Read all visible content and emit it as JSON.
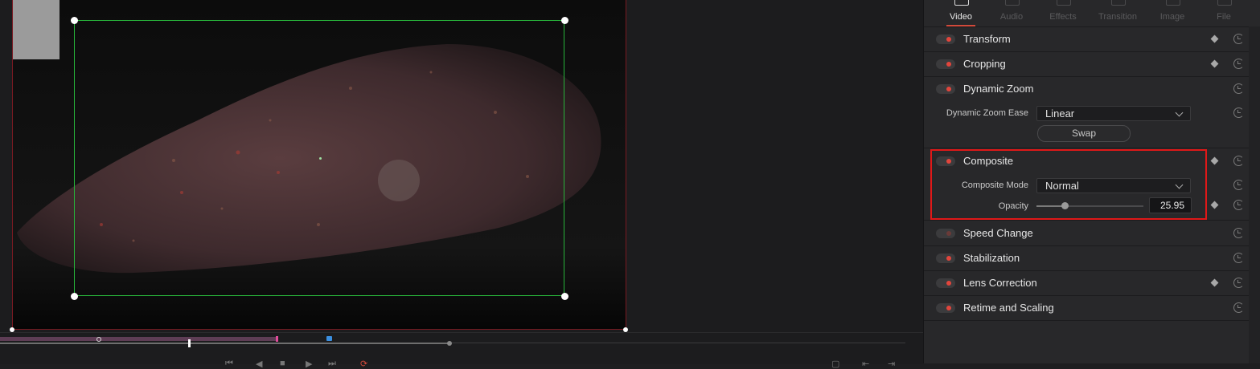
{
  "inspector": {
    "tabs": [
      {
        "label": "Video",
        "active": true
      },
      {
        "label": "Audio",
        "active": false
      },
      {
        "label": "Effects",
        "active": false
      },
      {
        "label": "Transition",
        "active": false
      },
      {
        "label": "Image",
        "active": false
      },
      {
        "label": "File",
        "active": false
      }
    ],
    "sections": {
      "transform": {
        "title": "Transform",
        "enabled": true
      },
      "cropping": {
        "title": "Cropping",
        "enabled": true
      },
      "dynamic_zoom": {
        "title": "Dynamic Zoom",
        "enabled": true,
        "ease_label": "Dynamic Zoom Ease",
        "ease_value": "Linear",
        "swap_label": "Swap"
      },
      "composite": {
        "title": "Composite",
        "enabled": true,
        "mode_label": "Composite Mode",
        "mode_value": "Normal",
        "opacity_label": "Opacity",
        "opacity_value": "25.95",
        "opacity_fraction": 0.26
      },
      "speed_change": {
        "title": "Speed Change",
        "enabled": false
      },
      "stabilization": {
        "title": "Stabilization",
        "enabled": true
      },
      "lens_correction": {
        "title": "Lens Correction",
        "enabled": true
      },
      "retime": {
        "title": "Retime and Scaling",
        "enabled": true
      }
    }
  },
  "colors": {
    "accent": "#e2453c",
    "selection_box": "#27b33a",
    "highlight": "#e01818",
    "clip_bar": "#5e3d55"
  }
}
